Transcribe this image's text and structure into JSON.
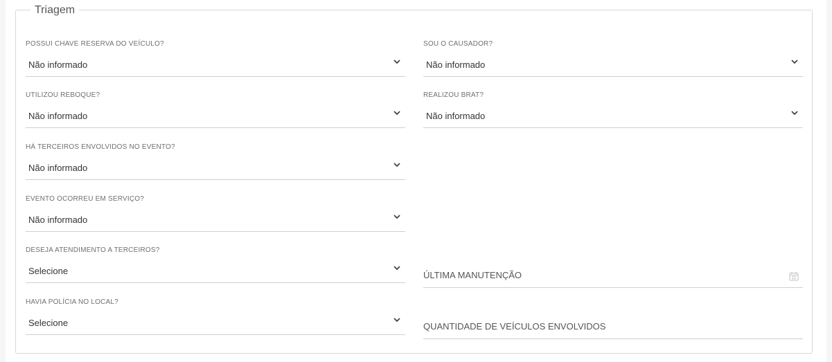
{
  "section": {
    "title": "Triagem"
  },
  "fields": {
    "chave_reserva": {
      "label": "POSSUI CHAVE RESERVA DO VEÍCULO?",
      "value": "Não informado"
    },
    "causador": {
      "label": "SOU O CAUSADOR?",
      "value": "Não informado"
    },
    "reboque": {
      "label": "UTILIZOU REBOQUE?",
      "value": "Não informado"
    },
    "brat": {
      "label": "REALIZOU BRAT?",
      "value": "Não informado"
    },
    "terceiros": {
      "label": "HÁ TERCEIROS ENVOLVIDOS NO EVENTO?",
      "value": "Não informado"
    },
    "servico": {
      "label": "EVENTO OCORREU EM SERVIÇO?",
      "value": "Não informado"
    },
    "atendimento_terceiros": {
      "label": "DESEJA ATENDIMENTO A TERCEIROS?",
      "value": "Selecione"
    },
    "policia": {
      "label": "HAVIA POLÍCIA NO LOCAL?",
      "value": "Selecione"
    },
    "ultima_manutencao": {
      "placeholder": "ÚLTIMA MANUTENÇÃO"
    },
    "quantidade_veiculos": {
      "placeholder": "QUANTIDADE DE VEÍCULOS ENVOLVIDOS"
    }
  },
  "icons": {
    "chevron": "chevron-down-icon",
    "calendar": "calendar-icon"
  },
  "colors": {
    "border": "#d8d8d8",
    "underline": "#cfcfcf",
    "text": "#333333",
    "label": "#6f6f6f"
  }
}
